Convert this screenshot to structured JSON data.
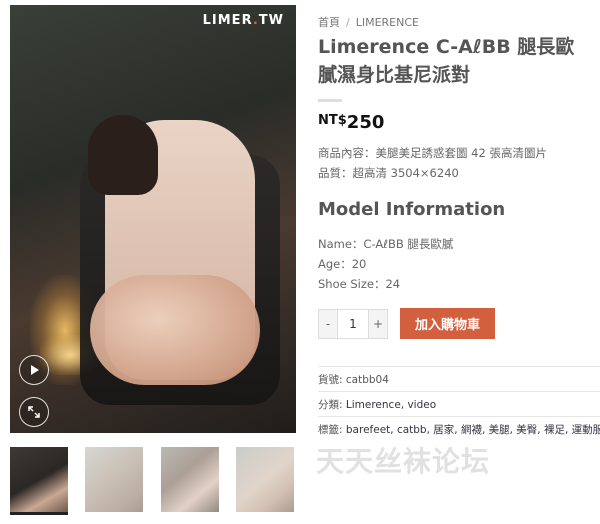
{
  "gallery": {
    "logo_main": "LIMER",
    "logo_dot": ".",
    "logo_tail": "TW",
    "play_icon": "play-icon",
    "expand_icon": "expand-icon",
    "thumbnails": [
      "thumbnail-1",
      "thumbnail-2",
      "thumbnail-3",
      "thumbnail-4"
    ]
  },
  "breadcrumb": {
    "home": "首頁",
    "separator": "/",
    "current": "LIMERENCE"
  },
  "product": {
    "title": "Limerence C-AℓBB 腿長歐膩濕身比基尼派對",
    "price_currency": "NT$",
    "price_amount": "250",
    "content_line": "商品內容：美腿美足誘惑套圖 42 張高清圖片",
    "quality_line": "品質：超高清 3504×6240"
  },
  "model_info": {
    "heading": "Model Information",
    "name_line": "Name：C-AℓBB 腿長歐膩",
    "age_line": "Age：20",
    "shoe_line": "Shoe Size：24"
  },
  "cart": {
    "minus": "-",
    "quantity": "1",
    "plus": "+",
    "add_button": "加入購物車"
  },
  "meta": {
    "sku_label": "貨號:",
    "sku_value": "catbb04",
    "category_label": "分類:",
    "category_value": "Limerence, video",
    "tags_label": "標籤:",
    "tags_value": "barefeet, catbb, 居家, 網襪, 美腿, 美臀, 裸足, 運動服, 馬克盾"
  },
  "watermark": "天天丝袜论坛",
  "colors": {
    "accent_button": "#d2603f",
    "logo_dot": "#e05a4a"
  }
}
